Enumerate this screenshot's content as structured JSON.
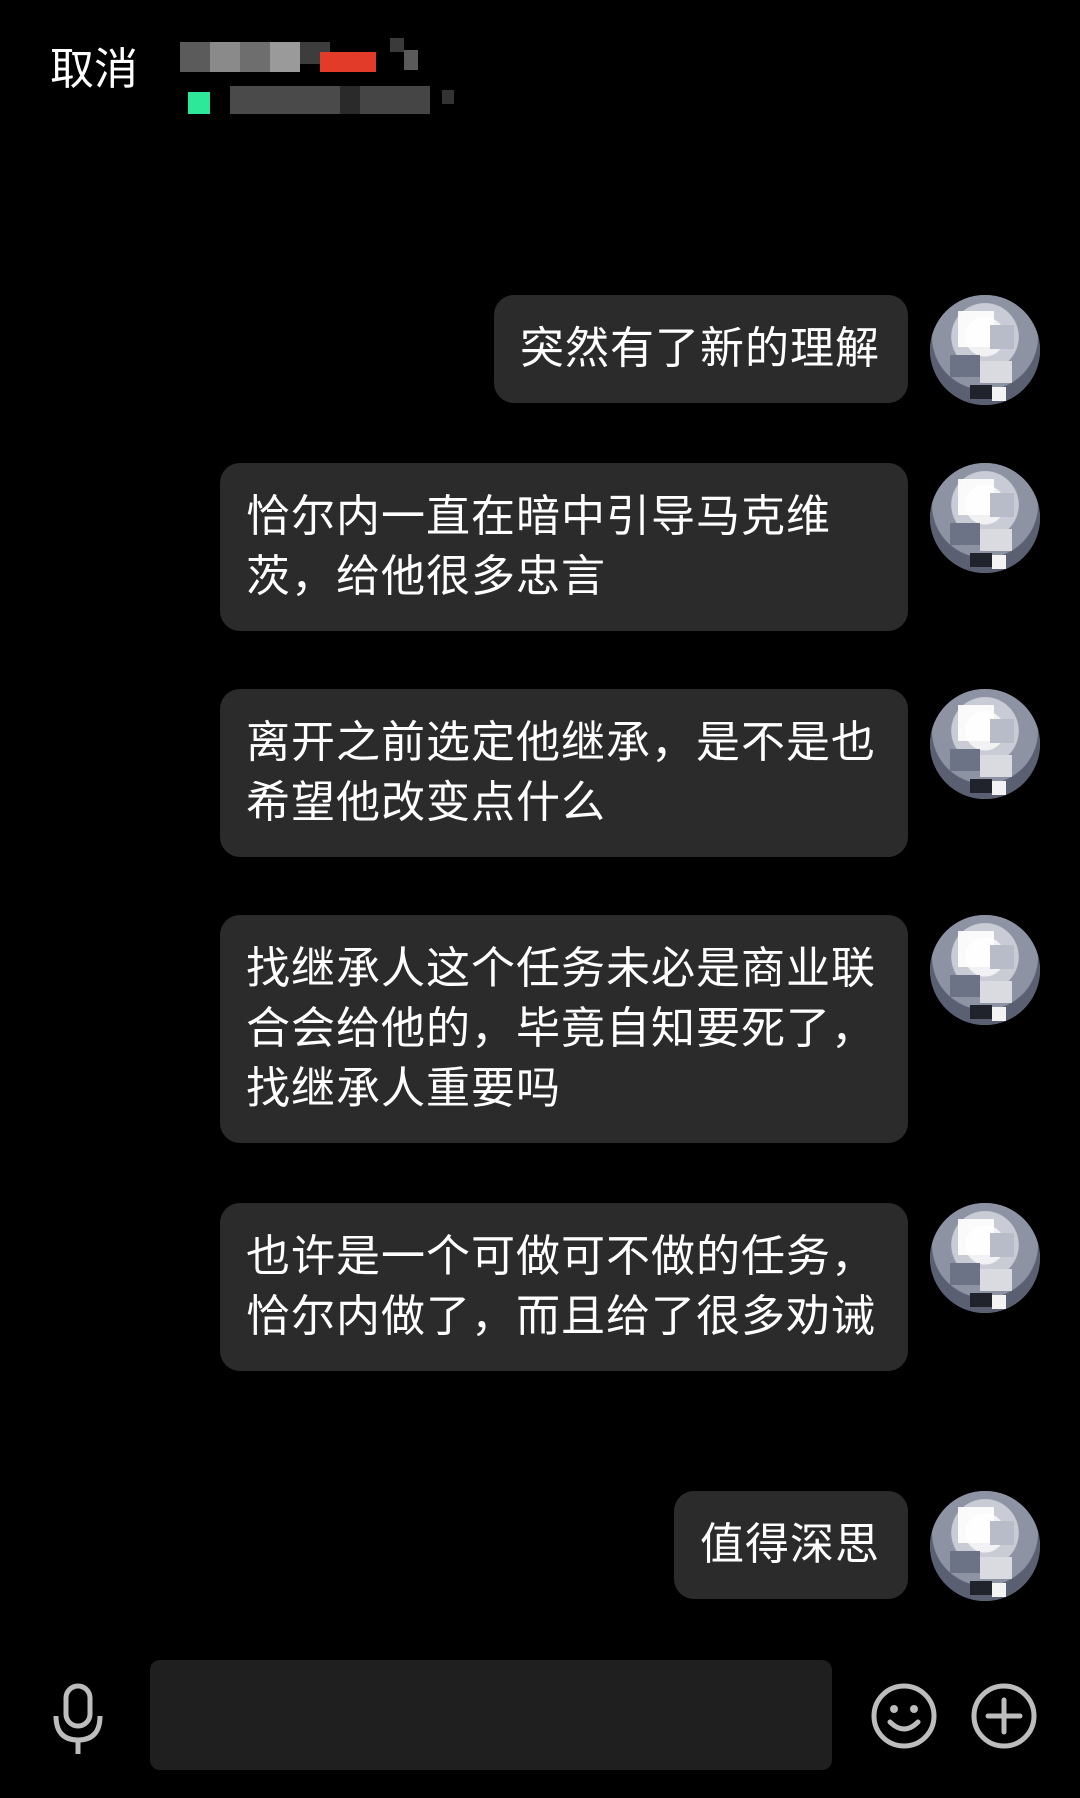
{
  "header": {
    "cancel_label": "取消"
  },
  "messages": [
    {
      "text": "突然有了新的理解"
    },
    {
      "text": "恰尔内一直在暗中引导马克维茨，给他很多忠言"
    },
    {
      "text": "离开之前选定他继承，是不是也希望他改变点什么"
    },
    {
      "text": "找继承人这个任务未必是商业联合会给他的，毕竟自知要死了，找继承人重要吗"
    },
    {
      "text": "也许是一个可做可不做的任务，恰尔内做了，而且给了很多劝诫"
    },
    {
      "text": "值得深思"
    }
  ],
  "input_bar": {
    "text_value": "",
    "icons": [
      "microphone-icon",
      "emoji-icon",
      "plus-icon"
    ]
  },
  "colors": {
    "background": "#000000",
    "bubble": "#2b2b2b",
    "text": "#ffffff",
    "online_status": "#2ee89a"
  }
}
